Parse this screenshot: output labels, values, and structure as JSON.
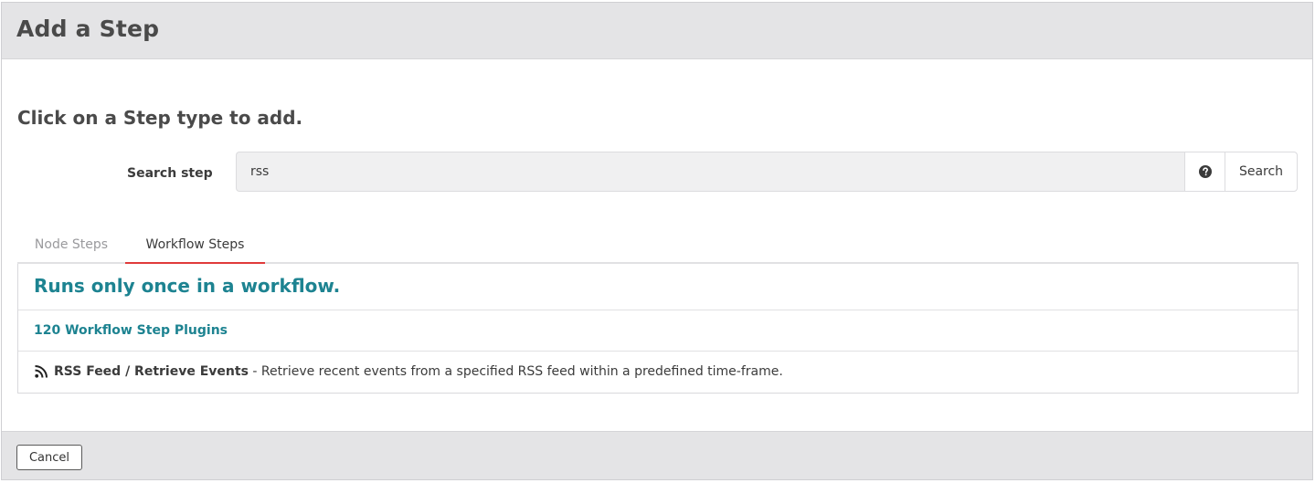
{
  "header": {
    "title": "Add a Step"
  },
  "main": {
    "prompt": "Click on a Step type to add.",
    "search": {
      "label": "Search step",
      "value": "rss",
      "help_icon": "question-circle-icon",
      "button_label": "Search"
    },
    "tabs": [
      {
        "label": "Node Steps",
        "active": false
      },
      {
        "label": "Workflow Steps",
        "active": true
      }
    ],
    "panel": {
      "heading": "Runs only once in a workflow.",
      "plugins_link": "120 Workflow Step Plugins",
      "steps": [
        {
          "icon": "rss-icon",
          "name": "RSS Feed / Retrieve Events",
          "description": " - Retrieve recent events from a specified RSS feed within a predefined time-frame."
        }
      ]
    }
  },
  "footer": {
    "cancel_label": "Cancel"
  },
  "colors": {
    "accent_teal": "#1d8391",
    "active_tab_underline": "#e03a3a",
    "header_bg": "#e4e4e6"
  }
}
